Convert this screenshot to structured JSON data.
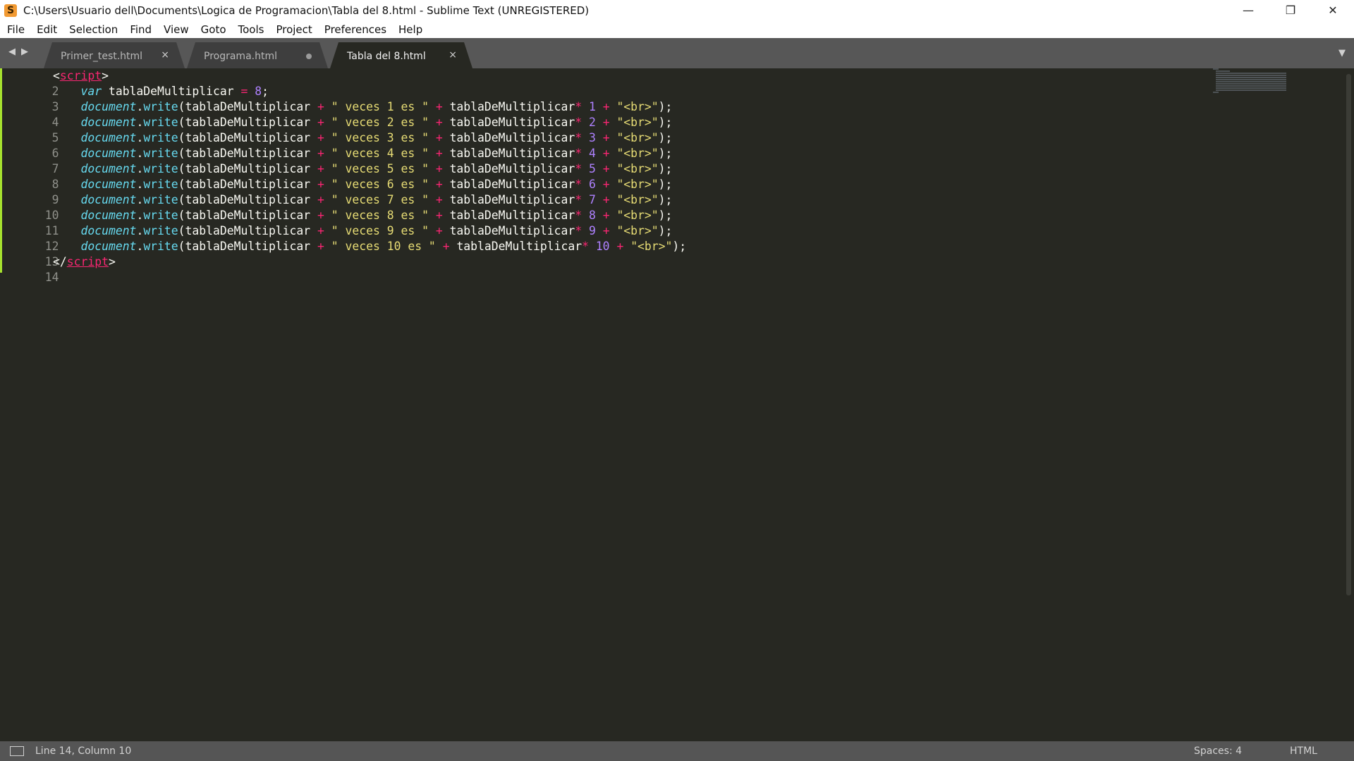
{
  "window": {
    "title": "C:\\Users\\Usuario dell\\Documents\\Logica de Programacion\\Tabla del 8.html - Sublime Text (UNREGISTERED)",
    "app_icon": "S",
    "controls": {
      "minimize": "—",
      "restore": "❐",
      "close": "✕"
    }
  },
  "menu": [
    "File",
    "Edit",
    "Selection",
    "Find",
    "View",
    "Goto",
    "Tools",
    "Project",
    "Preferences",
    "Help"
  ],
  "tabs": [
    {
      "label": "Primer_test.html",
      "state": "close"
    },
    {
      "label": "Programa.html",
      "state": "unsaved"
    },
    {
      "label": "Tabla del 8.html",
      "state": "active"
    }
  ],
  "tab_icons": {
    "back": "◀",
    "forward": "▶",
    "close": "×",
    "dropdown": "▼"
  },
  "code": {
    "line_numbers": [
      "2",
      "3",
      "4",
      "5",
      "6",
      "7",
      "8",
      "9",
      "10",
      "11",
      "12",
      "13",
      "14"
    ],
    "script_open_lt": "<",
    "script_tag": "script",
    "script_open_gt": ">",
    "script_close_lt": "</",
    "script_close_gt": ">",
    "var_kw": "var",
    "var_name": " tablaDeMultiplicar ",
    "var_eq": "=",
    "var_val": "8",
    "var_semi": ";",
    "write_lines": [
      {
        "str": "\" veces 1 es \"",
        "num": "1"
      },
      {
        "str": "\" veces 2 es \"",
        "num": "2"
      },
      {
        "str": "\" veces 3 es \"",
        "num": "3"
      },
      {
        "str": "\" veces 4 es \"",
        "num": "4"
      },
      {
        "str": "\" veces 5 es \"",
        "num": "5"
      },
      {
        "str": "\" veces 6 es \"",
        "num": "6"
      },
      {
        "str": "\" veces 7 es \"",
        "num": "7"
      },
      {
        "str": "\" veces 8 es \"",
        "num": "8"
      },
      {
        "str": "\" veces 9 es \"",
        "num": "9"
      },
      {
        "str": "\" veces 10 es \"",
        "num": "10"
      }
    ],
    "tokens": {
      "doc": "document",
      "dot": ".",
      "write": "write",
      "open": "(tablaDeMultiplicar ",
      "plus": "+",
      "ident": "tablaDeMultiplicar",
      "star": "*",
      "br": "\"<br>\"",
      "end": ");"
    }
  },
  "status": {
    "position": "Line 14, Column 10",
    "spaces": "Spaces: 4",
    "syntax": "HTML"
  },
  "colors": {
    "background": "#272822",
    "tag": "#f92672",
    "keyword": "#66d9ef",
    "string": "#e6db74",
    "number": "#ae81ff",
    "text": "#f8f8f2",
    "gutter_modified": "#a6e22e"
  }
}
